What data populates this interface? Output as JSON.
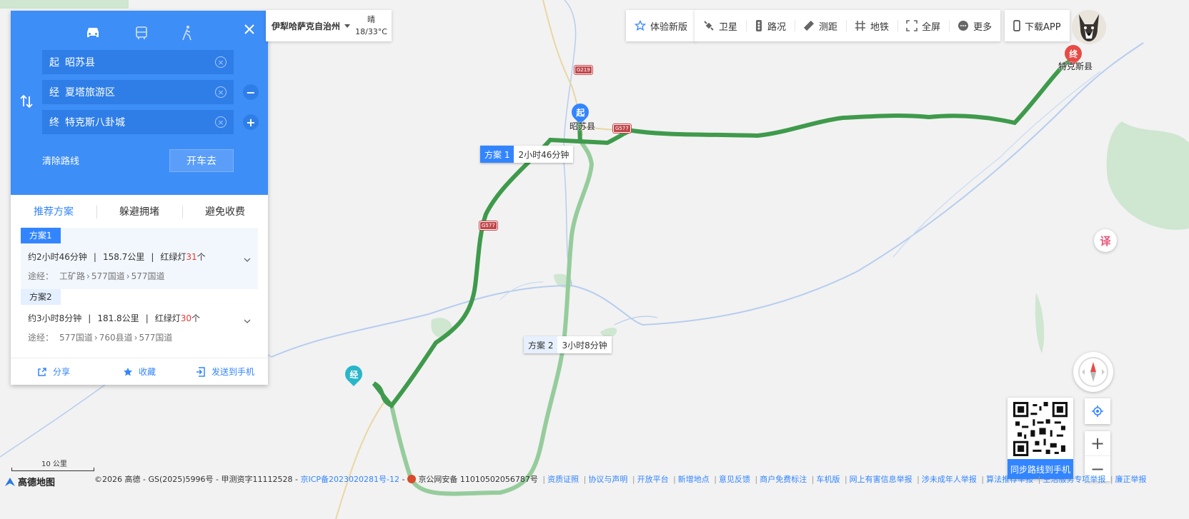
{
  "app": {
    "logo_text": "高德地图"
  },
  "panel": {
    "modes": [
      {
        "name": "drive-mode-icon"
      },
      {
        "name": "bus-mode-icon"
      },
      {
        "name": "walk-mode-icon"
      }
    ],
    "start": {
      "label": "起",
      "value": "昭苏县"
    },
    "via": {
      "label": "经",
      "value": "夏塔旅游区"
    },
    "end": {
      "label": "终",
      "value": "特克斯八卦城"
    },
    "remove_via": "−",
    "add_via": "+",
    "clear_route": "清除路线",
    "go_button": "开车去",
    "tabs": [
      "推荐方案",
      "躲避拥堵",
      "避免收费"
    ],
    "plans": [
      {
        "badge": "方案1",
        "duration": "约2小时46分钟",
        "distance": "158.7公里",
        "lights_prefix": "红绿灯",
        "lights": "31",
        "lights_suffix": "个",
        "via_label": "途经：",
        "roads": [
          "工矿路",
          "577国道",
          "577国道"
        ]
      },
      {
        "badge": "方案2",
        "duration": "约3小时8分钟",
        "distance": "181.8公里",
        "lights_prefix": "红绿灯",
        "lights": "30",
        "lights_suffix": "个",
        "via_label": "途经：",
        "roads": [
          "577国道",
          "760县道",
          "577国道"
        ]
      }
    ],
    "actions": {
      "share": "分享",
      "favorite": "收藏",
      "send": "发送到手机"
    }
  },
  "topbar": {
    "city": "伊犁哈萨克自治州",
    "weather": "晴",
    "temp": "18/33°C",
    "new_version": "体验新版",
    "tools": [
      "卫星",
      "路况",
      "测距",
      "地铁",
      "全屏",
      "更多"
    ],
    "download": "下载APP"
  },
  "map": {
    "start_city": "昭苏县",
    "end_city": "特克斯县",
    "start_pin": "起",
    "end_pin": "终",
    "via_pin": "经",
    "shields": [
      "G219",
      "G577",
      "G577"
    ],
    "route1": {
      "name": "方案 1",
      "time": "2小时46分钟"
    },
    "route2": {
      "name": "方案 2",
      "time": "3小时8分钟"
    },
    "colors": {
      "route_primary": "#3f9a4c",
      "route_secondary": "#96cc9c",
      "river": "#b7cdef"
    }
  },
  "controls": {
    "qr_label": "同步路线到手机",
    "zoom_in": "+",
    "zoom_out": "−",
    "translate": "译"
  },
  "scale": "10 公里",
  "footer": {
    "copyright": "©2026 高德 - GS(2025)5996号 - 甲测资字11112528 -",
    "icp": "京ICP备2023020281号-12",
    "police": "京公网安备 11010502056787号",
    "links": [
      "资质证照",
      "协议与声明",
      "开放平台",
      "新增地点",
      "意见反馈",
      "商户免费标注",
      "车机版",
      "网上有害信息举报",
      "涉未成年人举报",
      "算法推荐举报",
      "生活服务专项举报",
      "廉正举报"
    ]
  }
}
